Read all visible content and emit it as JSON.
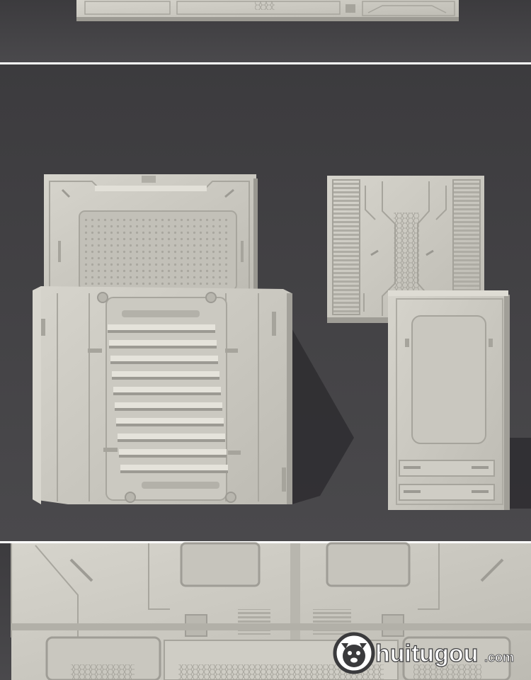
{
  "image": {
    "description_kind": "3D render preview sheet of sci-fi wall panel models",
    "background_color": "#464548",
    "panel_color": "#c7c5bd",
    "panel_shadow_color": "#8c8a84",
    "divider_color": "#ffffff"
  },
  "watermark": {
    "logo_glyph": "dog-face-icon",
    "brand_text": "huitugou",
    "domain_text": ".com",
    "text_color": "#ffffff",
    "outline_color": "#3a3a3c"
  }
}
